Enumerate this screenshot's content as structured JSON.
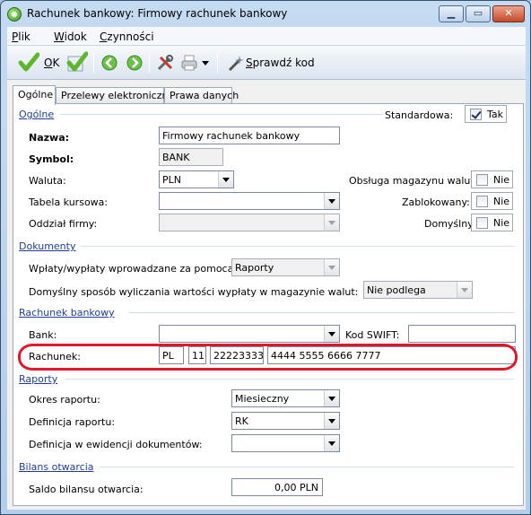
{
  "window": {
    "title": "Rachunek bankowy: Firmowy rachunek bankowy"
  },
  "menu": [
    {
      "key": "P",
      "rest": "lik"
    },
    {
      "key": "W",
      "rest": "idok"
    },
    {
      "key": "C",
      "rest": "zynności"
    }
  ],
  "toolbar": {
    "ok_label": "OK",
    "ok_key": "O",
    "ok_rest": "K",
    "check_key": "S",
    "check_rest": "prawdź kod"
  },
  "tabs": [
    "Ogólne",
    "Przelewy elektroniczne",
    "Prawa danych"
  ],
  "sections": {
    "general": "Ogólne",
    "documents": "Dokumenty",
    "bank_account": "Rachunek bankowy",
    "reports": "Raporty",
    "opening_balance": "Bilans otwarcia"
  },
  "general": {
    "standard_label": "Standardowa:",
    "standard_value": "Tak",
    "standard_checked": true,
    "name_label": "Nazwa:",
    "name_value": "Firmowy rachunek bankowy",
    "symbol_label": "Symbol:",
    "symbol_value": "BANK",
    "currency_label": "Waluta:",
    "currency_value": "PLN",
    "currency_wh_label": "Obsługa magazynu walut:",
    "currency_wh_value": "Nie",
    "rate_table_label": "Tabela kursowa:",
    "rate_table_value": "",
    "blocked_label": "Zablokowany:",
    "blocked_value": "Nie",
    "branch_label": "Oddział firmy:",
    "branch_value": "",
    "default_label": "Domyślny:",
    "default_value": "Nie"
  },
  "documents": {
    "inout_label": "Wpłaty/wypłaty wprowadzane za pomocą:",
    "inout_value": "Raporty",
    "calc_label": "Domyślny sposób wyliczania wartości wypłaty w magazynie walut:",
    "calc_value": "Nie podlega"
  },
  "bank_account": {
    "bank_label": "Bank:",
    "bank_value": "",
    "swift_label": "Kod SWIFT:",
    "swift_value": "",
    "account_label": "Rachunek:",
    "account_country": "PL",
    "account_check": "11",
    "account_bank": "22223333",
    "account_number": "4444 5555 6666 7777"
  },
  "reports": {
    "period_label": "Okres raportu:",
    "period_value": "Miesieczny",
    "definition_label": "Definicja raportu:",
    "definition_value": "RK",
    "doc_def_label": "Definicja w ewidencji dokumentów:",
    "doc_def_value": ""
  },
  "opening_balance": {
    "label": "Saldo bilansu otwarcia:",
    "value": "0,00 PLN"
  },
  "colors": {
    "section_text": "#1c3f94",
    "highlight": "#e0182b",
    "ok_green": "#5cb82a"
  }
}
